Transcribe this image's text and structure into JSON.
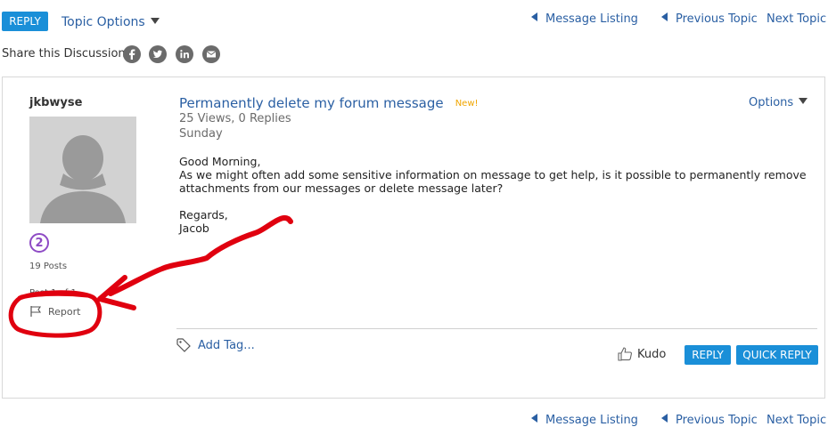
{
  "toolbar": {
    "reply_label": "REPLY",
    "topic_options_label": "Topic Options",
    "message_listing_label": "Message Listing",
    "previous_topic_label": "Previous Topic",
    "next_topic_label": "Next Topic"
  },
  "share": {
    "label": "Share this Discussion:",
    "icons": [
      "facebook-icon",
      "twitter-icon",
      "linkedin-icon",
      "email-icon"
    ]
  },
  "author": {
    "username": "jkbwyse",
    "rank_badge": "2",
    "posts": "19 Posts",
    "obscured_text": "Post 1 of 1",
    "report_label": "Report"
  },
  "message": {
    "title": "Permanently delete my forum message",
    "new_badge": "New!",
    "stats": "25 Views, 0 Replies",
    "date": "Sunday",
    "options_label": "Options",
    "body_lines": [
      "Good Morning,",
      "As we might often add some sensitive information on message to get help, is it possible to permanently remove",
      "attachments from our messages or delete message later?",
      "",
      "Regards,",
      "Jacob"
    ]
  },
  "footer": {
    "add_tag_label": "Add Tag...",
    "kudo_label": "Kudo",
    "reply_label": "REPLY",
    "quick_reply_label": "QUICK REPLY"
  },
  "bottom_nav": {
    "message_listing_label": "Message Listing",
    "previous_topic_label": "Previous Topic",
    "next_topic_label": "Next Topic"
  },
  "colors": {
    "accent": "#1a8fd8",
    "link": "#2a5fa3",
    "new_badge": "#f0a500",
    "annotation": "#e0000f",
    "rank_badge": "#8e4bc5"
  }
}
